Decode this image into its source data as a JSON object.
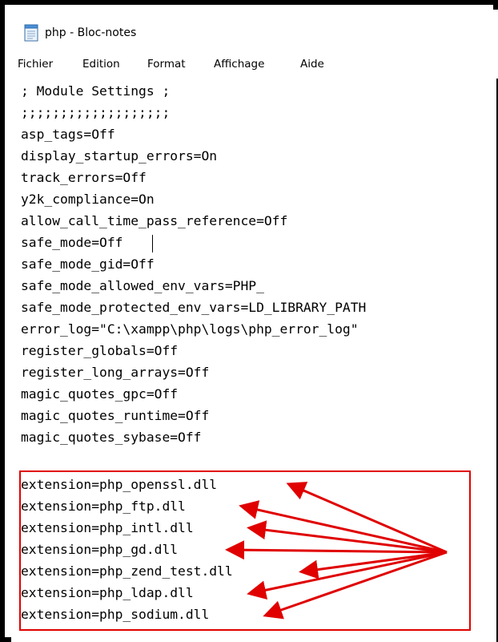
{
  "window": {
    "title": "php - Bloc-notes",
    "icon": "notepad-icon"
  },
  "menu": [
    "Fichier",
    "Edition",
    "Format",
    "Affichage",
    "Aide"
  ],
  "lines": [
    "; Module Settings ;",
    ";;;;;;;;;;;;;;;;;;;",
    "asp_tags=Off",
    "display_startup_errors=On",
    "track_errors=Off",
    "y2k_compliance=On",
    "allow_call_time_pass_reference=Off",
    "safe_mode=Off",
    "safe_mode_gid=Off",
    "safe_mode_allowed_env_vars=PHP_",
    "safe_mode_protected_env_vars=LD_LIBRARY_PATH",
    "error_log=\"C:\\xampp\\php\\logs\\php_error_log\"",
    "register_globals=Off",
    "register_long_arrays=Off",
    "magic_quotes_gpc=Off",
    "magic_quotes_runtime=Off",
    "magic_quotes_sybase=Off",
    "extension=php_openssl.dll",
    "extension=php_ftp.dll",
    "extension=php_intl.dll",
    "extension=php_gd.dll",
    "extension=php_zend_test.dll",
    "extension=php_ldap.dll",
    "extension=php_sodium.dll"
  ],
  "annotation": {
    "color": "#e00000",
    "highlighted_lines": [
      "extension=php_openssl.dll",
      "extension=php_ftp.dll",
      "extension=php_intl.dll",
      "extension=php_gd.dll",
      "extension=php_zend_test.dll",
      "extension=php_ldap.dll",
      "extension=php_sodium.dll"
    ]
  }
}
